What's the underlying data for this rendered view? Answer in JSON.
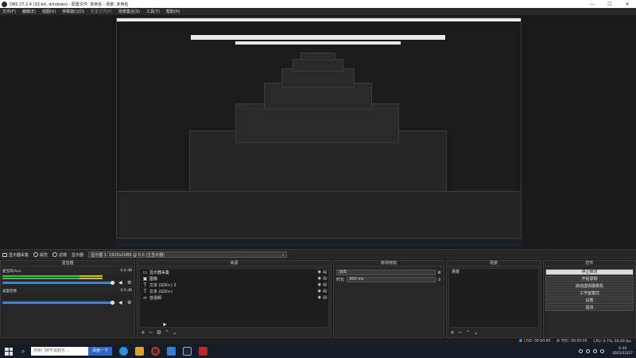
{
  "window": {
    "title": "OBS 27.2.4 (32-bit, windows) - 配置文件: 未命名 - 场景: 未命名",
    "minimize": "—",
    "maximize": "☐",
    "close": "✕"
  },
  "menu": [
    "文件(F)",
    "编辑(E)",
    "视图(V)",
    "停靠窗口(D)",
    "配置文件(P)",
    "场景集合(S)",
    "工具(T)",
    "帮助(H)"
  ],
  "source_toolbar": {
    "source_name": "显示器采集",
    "props_label": "属性",
    "filters_label": "滤镜",
    "display_label": "显示器",
    "display_value": "显示器 1: 1920x1080 @ 0,0 (主显示器)"
  },
  "mixer": {
    "header": "混音器",
    "tracks": [
      {
        "name": "麦克风/Aux",
        "db": "0.0 dB",
        "level": 0.78
      },
      {
        "name": "桌面音频",
        "db": "0.0 dB",
        "level": 0.0
      }
    ]
  },
  "sources": {
    "header": "来源",
    "items": [
      {
        "icon": "monitor-icon",
        "glyph": "▭",
        "name": "显示器采集"
      },
      {
        "icon": "image-icon",
        "glyph": "▣",
        "name": "图像"
      },
      {
        "icon": "text-icon",
        "glyph": "T",
        "name": "文本 (GDI+) 2"
      },
      {
        "icon": "text-icon",
        "glyph": "T",
        "name": "文本 (GDI+)"
      },
      {
        "icon": "link-icon",
        "glyph": "∞",
        "name": "音视频"
      }
    ]
  },
  "transitions": {
    "header": "转场特效",
    "type": "淡出",
    "duration_label": "时长",
    "duration": "300 ms"
  },
  "scenes": {
    "header": "场景",
    "items": [
      "场景"
    ]
  },
  "controls": {
    "header": "控件",
    "buttons": [
      "停止推流",
      "开始录制",
      "启动虚拟摄像机",
      "工作室模式",
      "设置",
      "退出"
    ]
  },
  "status": {
    "live": "LIVE: 00:00:00",
    "rec": "REC: 00:00:00",
    "cpu": "CPU: 0.7%, 60.00 fps"
  },
  "taskbar": {
    "search_placeholder": "搜索门牌号或服务...",
    "search_button": "百度一下",
    "time": "4:34",
    "date": "2022/12/27"
  },
  "colors": {
    "accent": "#4a7fd1",
    "meter_green": "#3fbf3f",
    "meter_yellow": "#c9c23a",
    "meter_red": "#c73a3a",
    "stop_stream_button": "#dcdcdc"
  }
}
